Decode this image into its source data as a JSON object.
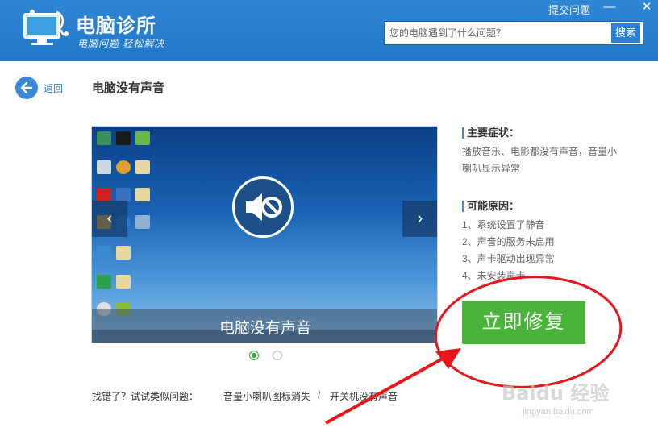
{
  "header": {
    "app_title": "电脑诊所",
    "tagline": "电脑问题 轻松解决",
    "feedback_link": "提交问题",
    "minimize": "—",
    "close": "✕",
    "search": {
      "placeholder": "您的电脑遇到了什么问题？",
      "button": "搜索"
    }
  },
  "nav": {
    "back_label": "返回"
  },
  "page": {
    "title": "电脑没有声音"
  },
  "slideshow": {
    "caption": "电脑没有声音",
    "prev": "‹",
    "next": "›",
    "slide_count": 2,
    "active_slide": 1
  },
  "symptoms": {
    "heading": "主要症状：",
    "text": "播放音乐、电影都没有声音，音量小喇叭显示异常"
  },
  "causes": {
    "heading": "可能原因：",
    "items": [
      "1、系统设置了静音",
      "2、声音的服务未启用",
      "3、声卡驱动出现异常",
      "4、未安装声卡"
    ]
  },
  "fix_button": "立即修复",
  "suggestions": {
    "prefix": "找错了？试试类似问题：",
    "links": [
      "音量小喇叭图标消失",
      "开关机没有声音"
    ],
    "separator": "/"
  },
  "watermark": {
    "brand": "Baidu 经验",
    "url": "jingyan.baidu.com"
  },
  "colors": {
    "header_blue": "#2f86d4",
    "fix_green": "#4ab43a",
    "annotation_red": "#e8161a",
    "link_blue": "#2f7fd1"
  }
}
